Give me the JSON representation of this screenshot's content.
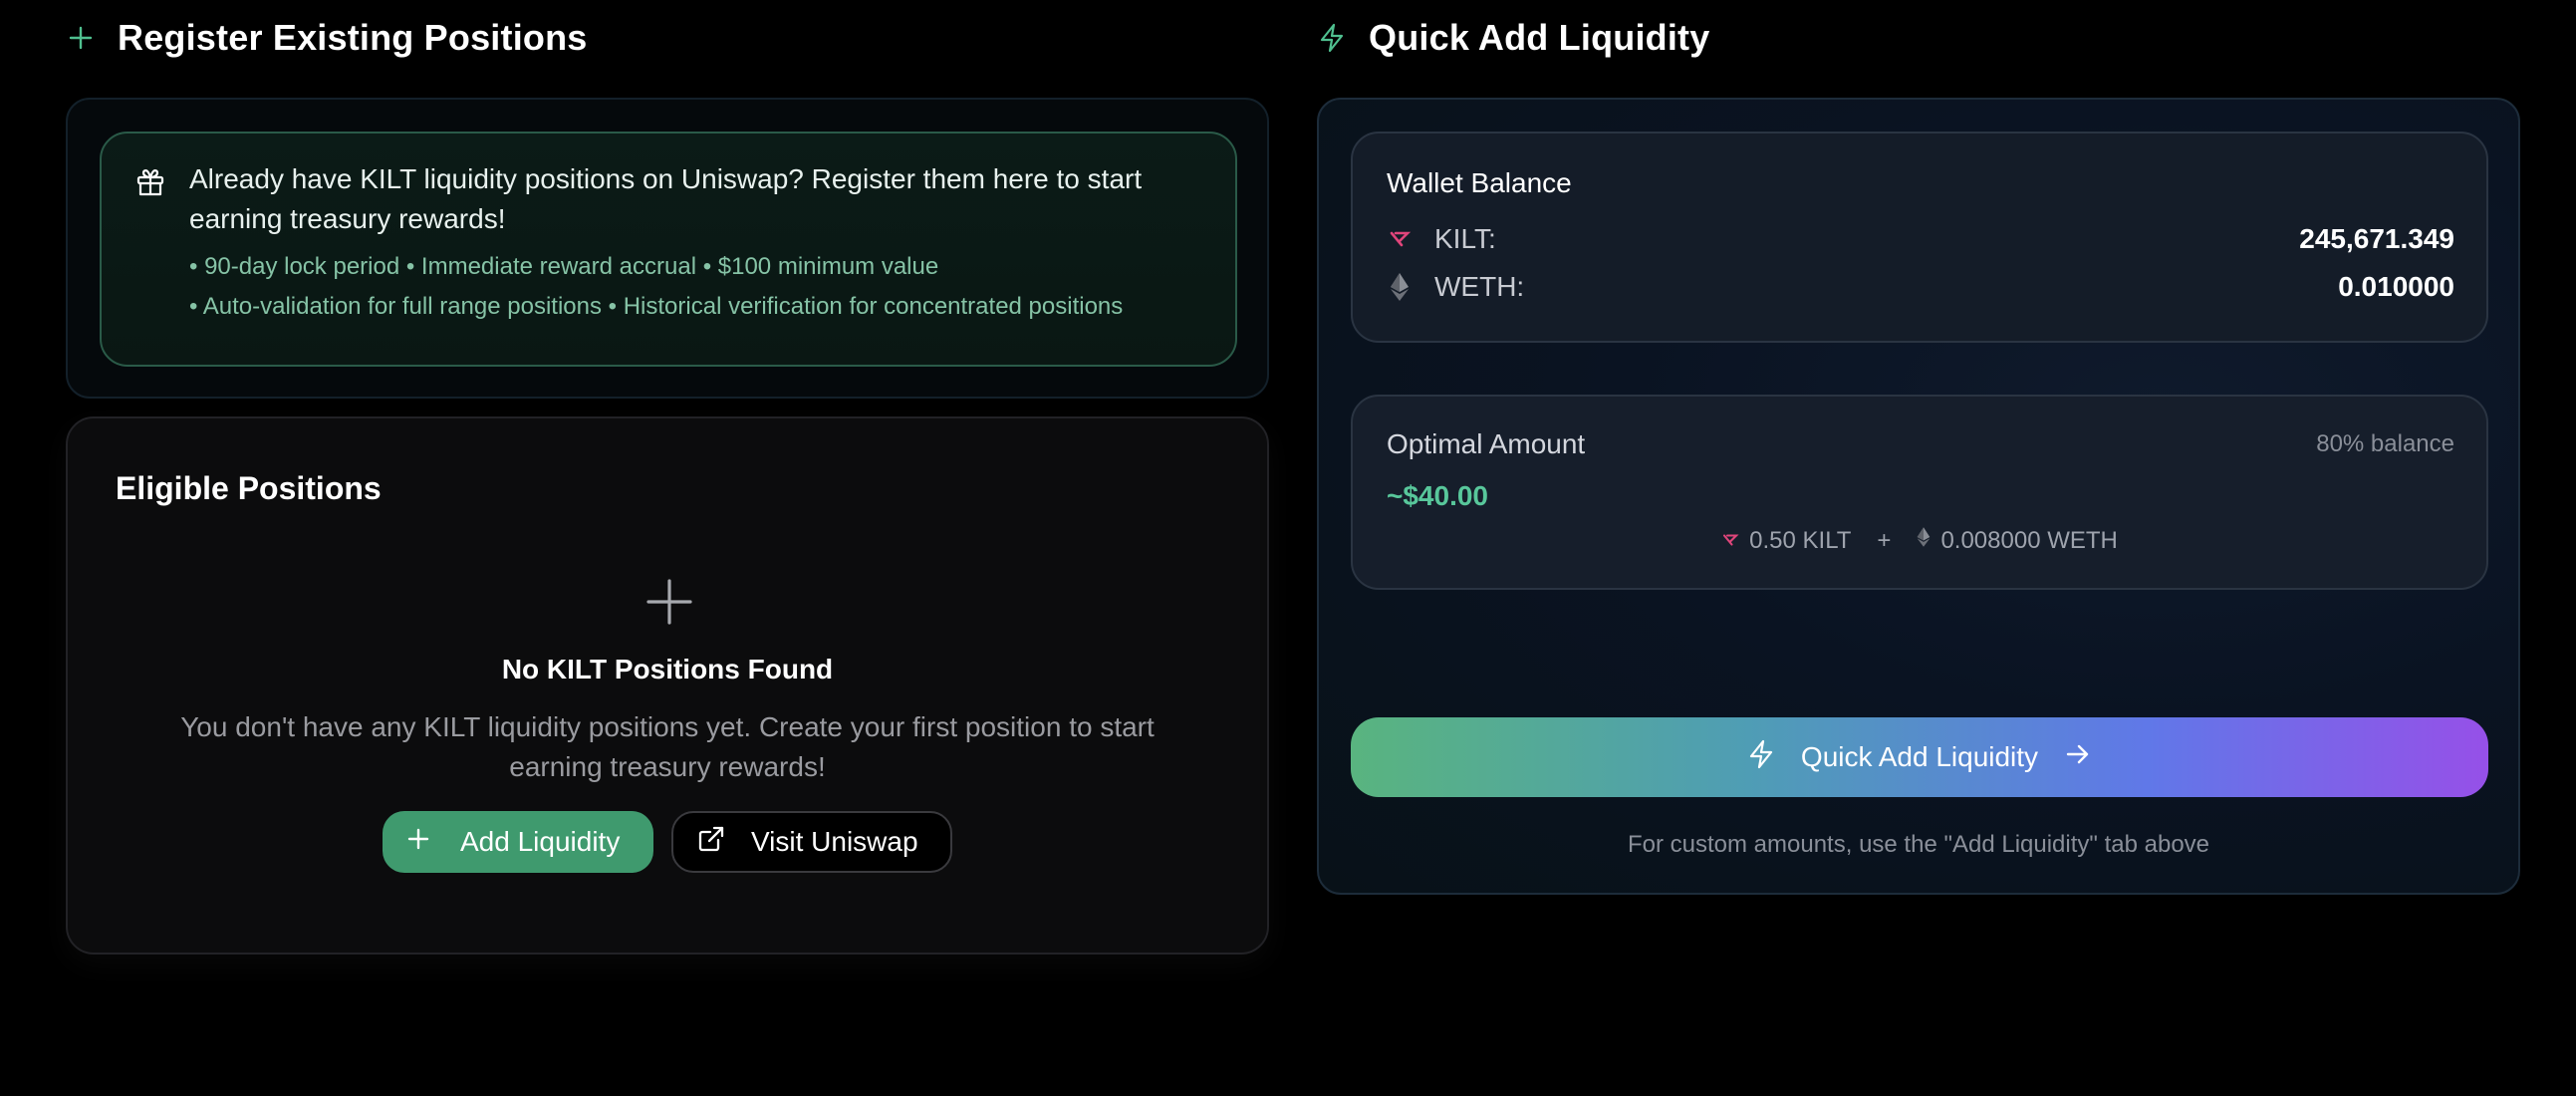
{
  "register": {
    "title": "Register Existing Positions",
    "info": {
      "main": "Already have KILT liquidity positions on Uniswap? Register them here to start earning treasury rewards!",
      "bullet1": "• 90-day lock period • Immediate reward accrual • $100 minimum value",
      "bullet2": "• Auto-validation for full range positions • Historical verification for concentrated positions"
    }
  },
  "eligible": {
    "title": "Eligible Positions",
    "empty_title": "No KILT Positions Found",
    "empty_desc": "You don't have any KILT liquidity positions yet. Create your first position to start earning treasury rewards!",
    "add_liquidity_label": "Add Liquidity",
    "visit_uniswap_label": "Visit Uniswap"
  },
  "quick_add": {
    "title": "Quick Add Liquidity",
    "wallet": {
      "title": "Wallet Balance",
      "tokens": [
        {
          "name": "KILT:",
          "value": "245,671.349",
          "icon": "kilt-icon"
        },
        {
          "name": "WETH:",
          "value": "0.010000",
          "icon": "eth-icon"
        }
      ]
    },
    "optimal": {
      "title": "Optimal Amount",
      "pct": "80% balance",
      "amount": "~$40.00",
      "kilt_amount": "0.50 KILT",
      "plus": "+",
      "weth_amount": "0.008000 WETH"
    },
    "button_label": "Quick Add Liquidity",
    "note": "For custom amounts, use the \"Add Liquidity\" tab above"
  },
  "colors": {
    "accent_green": "#58c79b",
    "kilt_pink": "#e0457b",
    "button_gradient": [
      "#59b47f",
      "#6078e8",
      "#9650e8"
    ]
  }
}
